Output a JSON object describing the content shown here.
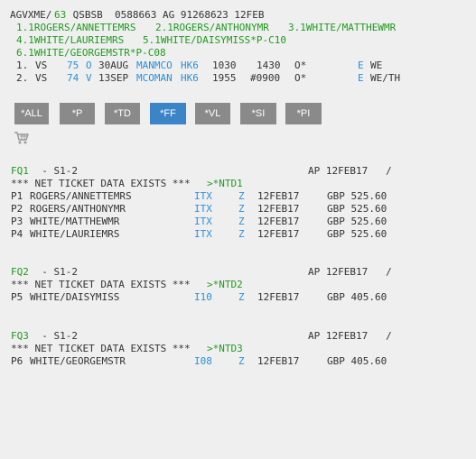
{
  "header": {
    "record_line": {
      "prefix": "AGVXME/",
      "pnr_code": "63",
      "rest": " QSBSB  0588663 AG 91268623 12FEB"
    }
  },
  "passengers": {
    "row1": [
      "1.1ROGERS/ANNETTEMRS",
      "2.1ROGERS/ANTHONYMR",
      "3.1WHITE/MATTHEWMR"
    ],
    "row2": [
      "4.1WHITE/LAURIEMRS",
      "5.1WHITE/DAISYMISS*P-C10"
    ],
    "row3": [
      "6.1WHITE/GEORGEMSTR*P-C08"
    ]
  },
  "segments": [
    {
      "num": "1.",
      "carrier": "VS",
      "flight": "75",
      "cls": "O",
      "date": "30AUG",
      "route": "MANMCO",
      "status": "HK6",
      "dep": "1030",
      "arr": "1430",
      "flag": "O*",
      "e": "E",
      "days": "WE"
    },
    {
      "num": "2.",
      "carrier": "VS",
      "flight": "74",
      "cls": "V",
      "date": "13SEP",
      "route": "MCOMAN",
      "status": "HK6",
      "dep": "1955",
      "arr": "#0900",
      "flag": "O*",
      "e": "E",
      "days": "WE/TH"
    }
  ],
  "toolbar": {
    "buttons": [
      "*ALL",
      "*P",
      "*TD",
      "*FF",
      "*VL",
      "*SI",
      "*PI"
    ],
    "active": "*FF"
  },
  "icons": {
    "cart": "shopping-cart-icon"
  },
  "fare_quotes": [
    {
      "fq": "FQ1",
      "seg": "  - S1-2",
      "ap": "AP 12FEB17   /",
      "net_prefix": "*** NET TICKET DATA EXISTS *** ",
      "net_link": ">*NTD1",
      "rows": [
        {
          "p": "P1",
          "name": "ROGERS/ANNETTEMRS",
          "fare": "ITX",
          "z": "Z",
          "date": "12FEB17",
          "amount": "GBP 525.60"
        },
        {
          "p": "P2",
          "name": "ROGERS/ANTHONYMR",
          "fare": "ITX",
          "z": "Z",
          "date": "12FEB17",
          "amount": "GBP 525.60"
        },
        {
          "p": "P3",
          "name": "WHITE/MATTHEWMR",
          "fare": "ITX",
          "z": "Z",
          "date": "12FEB17",
          "amount": "GBP 525.60"
        },
        {
          "p": "P4",
          "name": "WHITE/LAURIEMRS",
          "fare": "ITX",
          "z": "Z",
          "date": "12FEB17",
          "amount": "GBP 525.60"
        }
      ]
    },
    {
      "fq": "FQ2",
      "seg": "  - S1-2",
      "ap": "AP 12FEB17   /",
      "net_prefix": "*** NET TICKET DATA EXISTS *** ",
      "net_link": ">*NTD2",
      "rows": [
        {
          "p": "P5",
          "name": "WHITE/DAISYMISS",
          "fare": "I10",
          "z": "Z",
          "date": "12FEB17",
          "amount": "GBP 405.60"
        }
      ]
    },
    {
      "fq": "FQ3",
      "seg": "  - S1-2",
      "ap": "AP 12FEB17   /",
      "net_prefix": "*** NET TICKET DATA EXISTS *** ",
      "net_link": ">*NTD3",
      "rows": [
        {
          "p": "P6",
          "name": "WHITE/GEORGEMSTR",
          "fare": "I08",
          "z": "Z",
          "date": "12FEB17",
          "amount": "GBP 405.60"
        }
      ]
    }
  ]
}
